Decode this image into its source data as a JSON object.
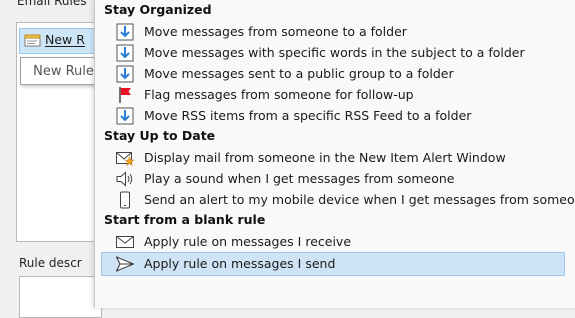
{
  "background_dialog": {
    "title": "Email Rules",
    "new_rule_button": "New R",
    "tooltip": "New Rule",
    "rule_description_label": "Rule descr"
  },
  "menu": {
    "sections": [
      {
        "heading": "Stay Organized",
        "items": [
          {
            "label": "Move messages from someone to a folder",
            "icon": "move-folder-icon"
          },
          {
            "label": "Move messages with specific words in the subject to a folder",
            "icon": "move-folder-icon"
          },
          {
            "label": "Move messages sent to a public group to a folder",
            "icon": "move-folder-icon"
          },
          {
            "label": "Flag messages from someone for follow-up",
            "icon": "red-flag-icon"
          },
          {
            "label": "Move RSS items from a specific RSS Feed to a folder",
            "icon": "move-folder-icon"
          }
        ]
      },
      {
        "heading": "Stay Up to Date",
        "items": [
          {
            "label": "Display mail from someone in the New Item Alert Window",
            "icon": "mail-star-icon"
          },
          {
            "label": "Play a sound when I get messages from someone",
            "icon": "speaker-icon"
          },
          {
            "label": "Send an alert to my mobile device when I get messages from someone",
            "icon": "mobile-phone-icon"
          }
        ]
      },
      {
        "heading": "Start from a blank rule",
        "items": [
          {
            "label": "Apply rule on messages I receive",
            "icon": "envelope-icon"
          },
          {
            "label": "Apply rule on messages I send",
            "icon": "send-arrow-icon",
            "selected": true
          }
        ]
      }
    ]
  },
  "colors": {
    "selection_background": "#cfe3f6",
    "selection_border": "#9dc6ea",
    "folder_arrow_blue": "#2b7cd3",
    "flag_red": "#e81123"
  }
}
